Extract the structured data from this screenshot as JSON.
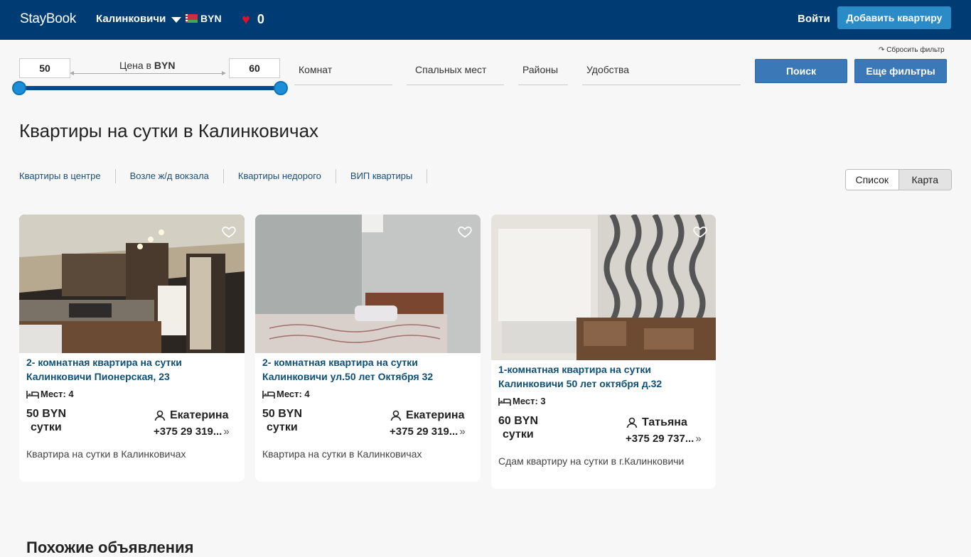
{
  "header": {
    "logo": "StayBook",
    "city": "Калинковичи",
    "currency": "BYN",
    "favorites_count": "0",
    "login": "Войти",
    "add_button": "Добавить квартиру"
  },
  "filters": {
    "price_min": "50",
    "price_max": "60",
    "price_label": "Цена в",
    "price_currency": "BYN",
    "rooms": "Комнат",
    "beds": "Спальных мест",
    "districts": "Районы",
    "amenities": "Удобства",
    "reset": "Сбросить фильтр",
    "search": "Поиск",
    "more": "Еще фильтры"
  },
  "page_title": "Квартиры на сутки в Калинковичах",
  "quick_links": [
    "Квартиры в центре",
    "Возле ж/д вокзала",
    "Квартиры недорого",
    "ВИП квартиры"
  ],
  "view_toggle": {
    "list": "Список",
    "map": "Карта"
  },
  "listings": [
    {
      "title_line1": "2- комнатная квартира на сутки",
      "title_line2": "Калинковичи Пионерская, 23",
      "places": "Мест: 4",
      "price": "50 BYN",
      "per": "сутки",
      "owner": "Екатерина",
      "phone": "+375 29 319...",
      "desc": "Квартира на сутки в Калинковичах"
    },
    {
      "title_line1": "2- комнатная квартира на сутки",
      "title_line2": "Калинковичи ул.50 лет Октября 32",
      "places": "Мест: 4",
      "price": "50 BYN",
      "per": "сутки",
      "owner": "Екатерина",
      "phone": "+375 29 319...",
      "desc": "Квартира на сутки в Калинковичах"
    },
    {
      "title_line1": "1-комнатная квартира на сутки",
      "title_line2": "Калинковичи 50 лет октября д.32",
      "places": "Мест: 3",
      "price": "60 BYN",
      "per": "сутки",
      "owner": "Татьяна",
      "phone": "+375 29 737...",
      "desc": "Сдам квартиру на сутки в г.Калинковичи"
    }
  ],
  "bottom_heading": "Похожие объявления"
}
